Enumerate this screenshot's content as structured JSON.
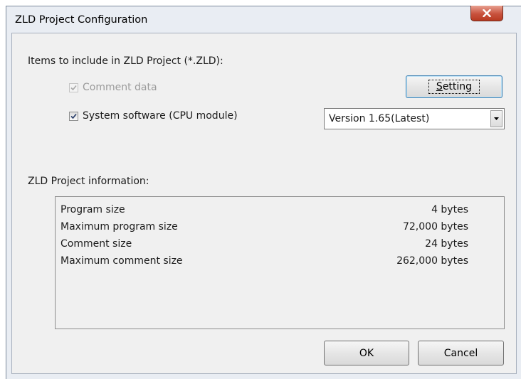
{
  "window": {
    "title": "ZLD Project Configuration"
  },
  "items_section": {
    "label": "Items to include in ZLD Project (*.ZLD):",
    "comment_data": {
      "label": "Comment data",
      "checked": true,
      "enabled": false
    },
    "system_software": {
      "label": "System software (CPU module)",
      "checked": true,
      "enabled": true
    },
    "setting_button": {
      "prefix": "",
      "mnemonic": "S",
      "rest": "etting"
    },
    "version_select": {
      "value": "Version 1.65(Latest)"
    }
  },
  "info_section": {
    "label": "ZLD Project information:",
    "rows": [
      {
        "name": "Program size",
        "value": "4 bytes"
      },
      {
        "name": "Maximum program size",
        "value": "72,000 bytes"
      },
      {
        "name": "Comment size",
        "value": "24 bytes"
      },
      {
        "name": "Maximum comment size",
        "value": "262,000 bytes"
      }
    ]
  },
  "footer": {
    "ok_label": "OK",
    "cancel_label": "Cancel"
  },
  "icons": {
    "close": "close-icon",
    "check": "checkmark-icon",
    "dropdown": "chevron-down-icon"
  }
}
